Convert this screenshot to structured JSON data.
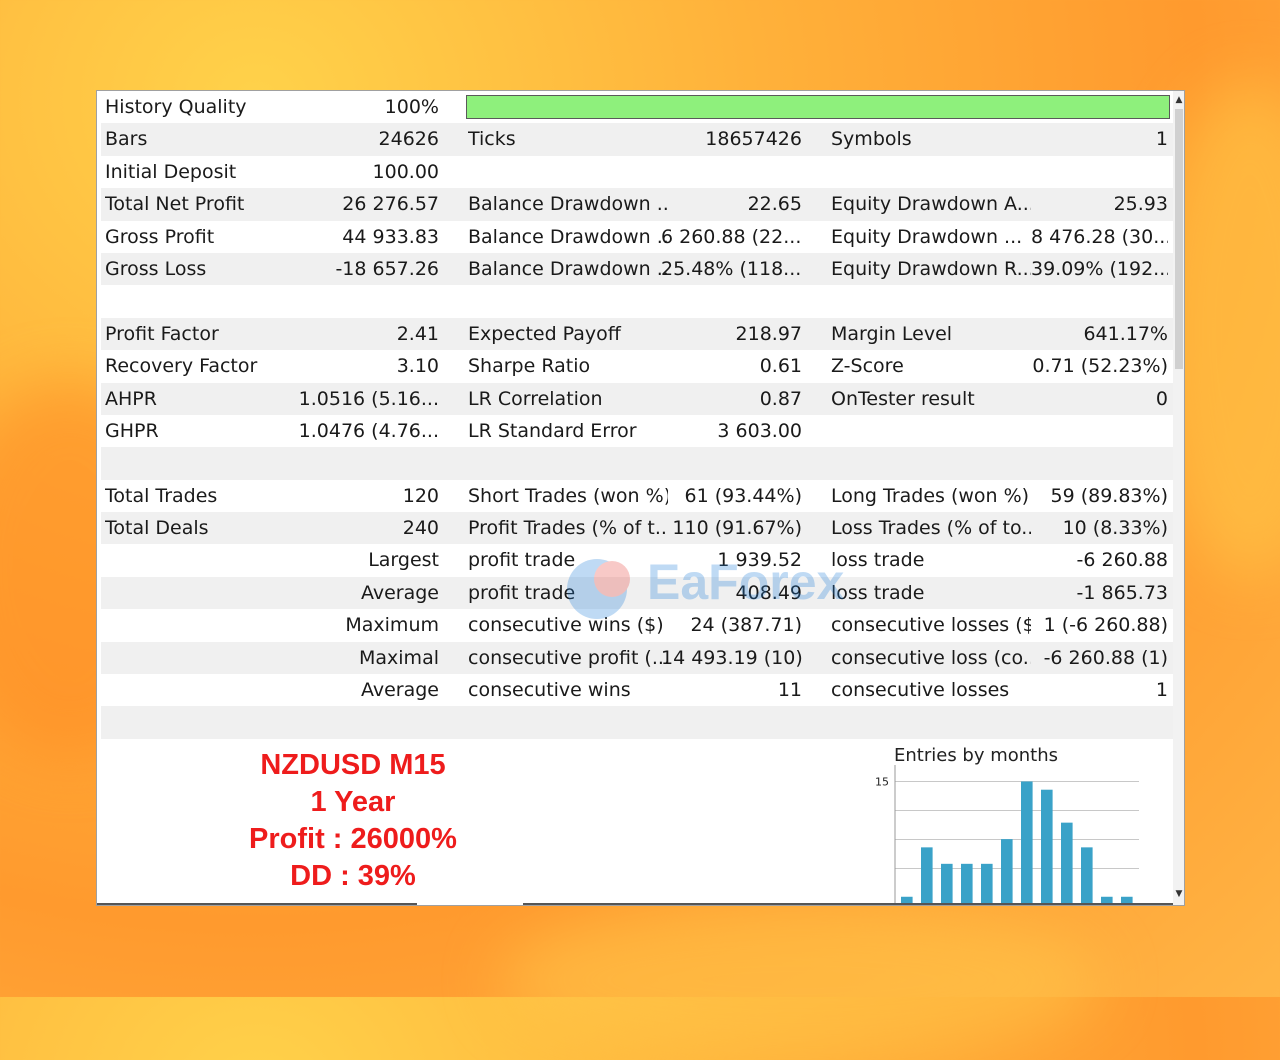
{
  "stats": {
    "rows": [
      {
        "shade": false,
        "cells": [
          [
            "History Quality",
            "100%"
          ]
        ],
        "progress_bar": true
      },
      {
        "shade": true,
        "cells": [
          [
            "Bars",
            "24626"
          ],
          [
            "Ticks",
            "18657426"
          ],
          [
            "Symbols",
            "1"
          ]
        ]
      },
      {
        "shade": false,
        "cells": [
          [
            "Initial Deposit",
            "100.00"
          ]
        ]
      },
      {
        "shade": true,
        "cells": [
          [
            "Total Net Profit",
            "26 276.57"
          ],
          [
            "Balance Drawdown ...",
            "22.65"
          ],
          [
            "Equity Drawdown A...",
            "25.93"
          ]
        ]
      },
      {
        "shade": false,
        "cells": [
          [
            "Gross Profit",
            "44 933.83"
          ],
          [
            "Balance Drawdown ...",
            "6 260.88 (22...."
          ],
          [
            "Equity Drawdown ...",
            "8 476.28 (30...."
          ]
        ]
      },
      {
        "shade": true,
        "cells": [
          [
            "Gross Loss",
            "-18 657.26"
          ],
          [
            "Balance Drawdown ...",
            "25.48% (118...."
          ],
          [
            "Equity Drawdown R...",
            "39.09% (192...."
          ]
        ]
      },
      {
        "shade": false,
        "cells": []
      },
      {
        "shade": true,
        "cells": [
          [
            "Profit Factor",
            "2.41"
          ],
          [
            "Expected Payoff",
            "218.97"
          ],
          [
            "Margin Level",
            "641.17%"
          ]
        ]
      },
      {
        "shade": false,
        "cells": [
          [
            "Recovery Factor",
            "3.10"
          ],
          [
            "Sharpe Ratio",
            "0.61"
          ],
          [
            "Z-Score",
            "0.71 (52.23%)"
          ]
        ]
      },
      {
        "shade": true,
        "cells": [
          [
            "AHPR",
            "1.0516 (5.16..."
          ],
          [
            "LR Correlation",
            "0.87"
          ],
          [
            "OnTester result",
            "0"
          ]
        ]
      },
      {
        "shade": false,
        "cells": [
          [
            "GHPR",
            "1.0476 (4.76..."
          ],
          [
            "LR Standard Error",
            "3 603.00"
          ]
        ]
      },
      {
        "shade": true,
        "cells": []
      },
      {
        "shade": false,
        "cells": [
          [
            "Total Trades",
            "120"
          ],
          [
            "Short Trades (won %)",
            "61 (93.44%)"
          ],
          [
            "Long Trades (won %)",
            "59 (89.83%)"
          ]
        ]
      },
      {
        "shade": true,
        "cells": [
          [
            "Total Deals",
            "240"
          ],
          [
            "Profit Trades (% of t...",
            "110 (91.67%)"
          ],
          [
            "Loss Trades (% of to...",
            "10 (8.33%)"
          ]
        ]
      },
      {
        "shade": false,
        "right_label": "Largest",
        "cells": [
          [
            "profit trade",
            "1 939.52"
          ],
          [
            "loss trade",
            "-6 260.88"
          ]
        ]
      },
      {
        "shade": true,
        "right_label": "Average",
        "cells": [
          [
            "profit trade",
            "408.49"
          ],
          [
            "loss trade",
            "-1 865.73"
          ]
        ]
      },
      {
        "shade": false,
        "right_label": "Maximum",
        "cells": [
          [
            "consecutive wins ($)",
            "24 (387.71)"
          ],
          [
            "consecutive losses ($)",
            "1 (-6 260.88)"
          ]
        ]
      },
      {
        "shade": true,
        "right_label": "Maximal",
        "cells": [
          [
            "consecutive profit (...",
            "14 493.19 (10)"
          ],
          [
            "consecutive loss (co...",
            "-6 260.88 (1)"
          ]
        ]
      },
      {
        "shade": false,
        "right_label": "Average",
        "cells": [
          [
            "consecutive wins",
            "11"
          ],
          [
            "consecutive losses",
            "1"
          ]
        ]
      },
      {
        "shade": true,
        "cells": []
      }
    ]
  },
  "history_quality_percent": 100,
  "promo": {
    "line1": "NZDUSD M15",
    "line2": "1 Year",
    "line3": "Profit : 26000%",
    "line4": "DD : 39%"
  },
  "chart_data": {
    "type": "bar",
    "title": "Entries by months",
    "ytick": "15",
    "ylim": [
      0,
      17
    ],
    "values": [
      1,
      7,
      5,
      5,
      5,
      8,
      15,
      14,
      10,
      7,
      1,
      1
    ]
  },
  "watermark": {
    "text": "EaForex"
  },
  "colors": {
    "progress": "#8ef07c",
    "bar": "#3aa2c8",
    "promo": "#ee1c1c",
    "row_shade": "#f0f0f0"
  }
}
